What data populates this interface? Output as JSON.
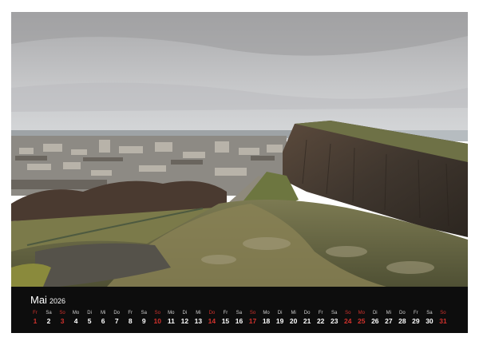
{
  "calendar": {
    "month": "Mai",
    "year": "2026",
    "days": [
      {
        "n": "Fr",
        "d": "1",
        "we": true
      },
      {
        "n": "Sa",
        "d": "2",
        "we": false
      },
      {
        "n": "So",
        "d": "3",
        "we": true
      },
      {
        "n": "Mo",
        "d": "4",
        "we": false
      },
      {
        "n": "Di",
        "d": "5",
        "we": false
      },
      {
        "n": "Mi",
        "d": "6",
        "we": false
      },
      {
        "n": "Do",
        "d": "7",
        "we": false
      },
      {
        "n": "Fr",
        "d": "8",
        "we": false
      },
      {
        "n": "Sa",
        "d": "9",
        "we": false
      },
      {
        "n": "So",
        "d": "10",
        "we": true
      },
      {
        "n": "Mo",
        "d": "11",
        "we": false
      },
      {
        "n": "Di",
        "d": "12",
        "we": false
      },
      {
        "n": "Mi",
        "d": "13",
        "we": false
      },
      {
        "n": "Do",
        "d": "14",
        "we": true
      },
      {
        "n": "Fr",
        "d": "15",
        "we": false
      },
      {
        "n": "Sa",
        "d": "16",
        "we": false
      },
      {
        "n": "So",
        "d": "17",
        "we": true
      },
      {
        "n": "Mo",
        "d": "18",
        "we": false
      },
      {
        "n": "Di",
        "d": "19",
        "we": false
      },
      {
        "n": "Mi",
        "d": "20",
        "we": false
      },
      {
        "n": "Do",
        "d": "21",
        "we": false
      },
      {
        "n": "Fr",
        "d": "22",
        "we": false
      },
      {
        "n": "Sa",
        "d": "23",
        "we": false
      },
      {
        "n": "So",
        "d": "24",
        "we": true
      },
      {
        "n": "Mo",
        "d": "25",
        "we": true
      },
      {
        "n": "Di",
        "d": "26",
        "we": false
      },
      {
        "n": "Mi",
        "d": "27",
        "we": false
      },
      {
        "n": "Do",
        "d": "28",
        "we": false
      },
      {
        "n": "Fr",
        "d": "29",
        "we": false
      },
      {
        "n": "Sa",
        "d": "30",
        "we": false
      },
      {
        "n": "So",
        "d": "31",
        "we": true
      }
    ]
  },
  "colors": {
    "weekend": "#d2322d",
    "bar": "#0d0d0d"
  }
}
